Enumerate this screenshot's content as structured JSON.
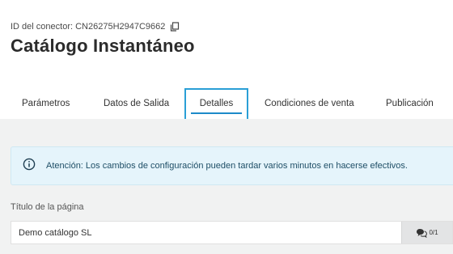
{
  "header": {
    "connector_id_label": "ID del conector: CN26275H2947C9662",
    "title": "Catálogo Instantáneo"
  },
  "tabs": [
    {
      "label": "Parámetros",
      "active": false
    },
    {
      "label": "Datos de Salida",
      "active": false
    },
    {
      "label": "Detalles",
      "active": true
    },
    {
      "label": "Condiciones de venta",
      "active": false
    },
    {
      "label": "Publicación",
      "active": false
    }
  ],
  "alert": {
    "icon": "info-icon",
    "text": "Atención: Los cambios de configuración pueden tardar varios minutos en hacerse efectivos."
  },
  "form": {
    "page_title_label": "Título de la página",
    "page_title_value": "Demo catálogo SL",
    "counter": "0/1",
    "counter_icon": "comment-icon"
  },
  "colors": {
    "accent": "#2a9fd6",
    "content_bg": "#f1f2f2",
    "alert_bg": "#e5f4fb"
  }
}
